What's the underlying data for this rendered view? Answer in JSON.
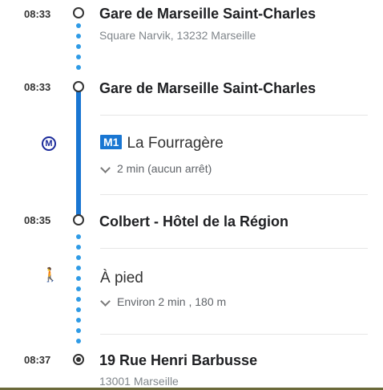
{
  "stops": [
    {
      "time": "08:33",
      "name": "Gare de Marseille Saint-Charles",
      "address": "Square Narvik, 13232 Marseille"
    },
    {
      "time": "08:33",
      "name": "Gare de Marseille Saint-Charles"
    },
    {
      "time": "08:35",
      "name": "Colbert - Hôtel de la Région"
    },
    {
      "time": "08:37",
      "name": "19 Rue Henri Barbusse",
      "address": "13001 Marseille"
    }
  ],
  "metro": {
    "icon": "metro-icon",
    "icon_glyph": "M",
    "line": "M1",
    "direction": "La Fourragère",
    "duration": "2 min (aucun arrêt)",
    "line_color": "#1976d2"
  },
  "walk": {
    "icon": "walking-person-icon",
    "icon_glyph": "🚶",
    "label": "À pied",
    "detail": "Environ 2 min , 180 m",
    "dot_color": "#2f9be6"
  }
}
